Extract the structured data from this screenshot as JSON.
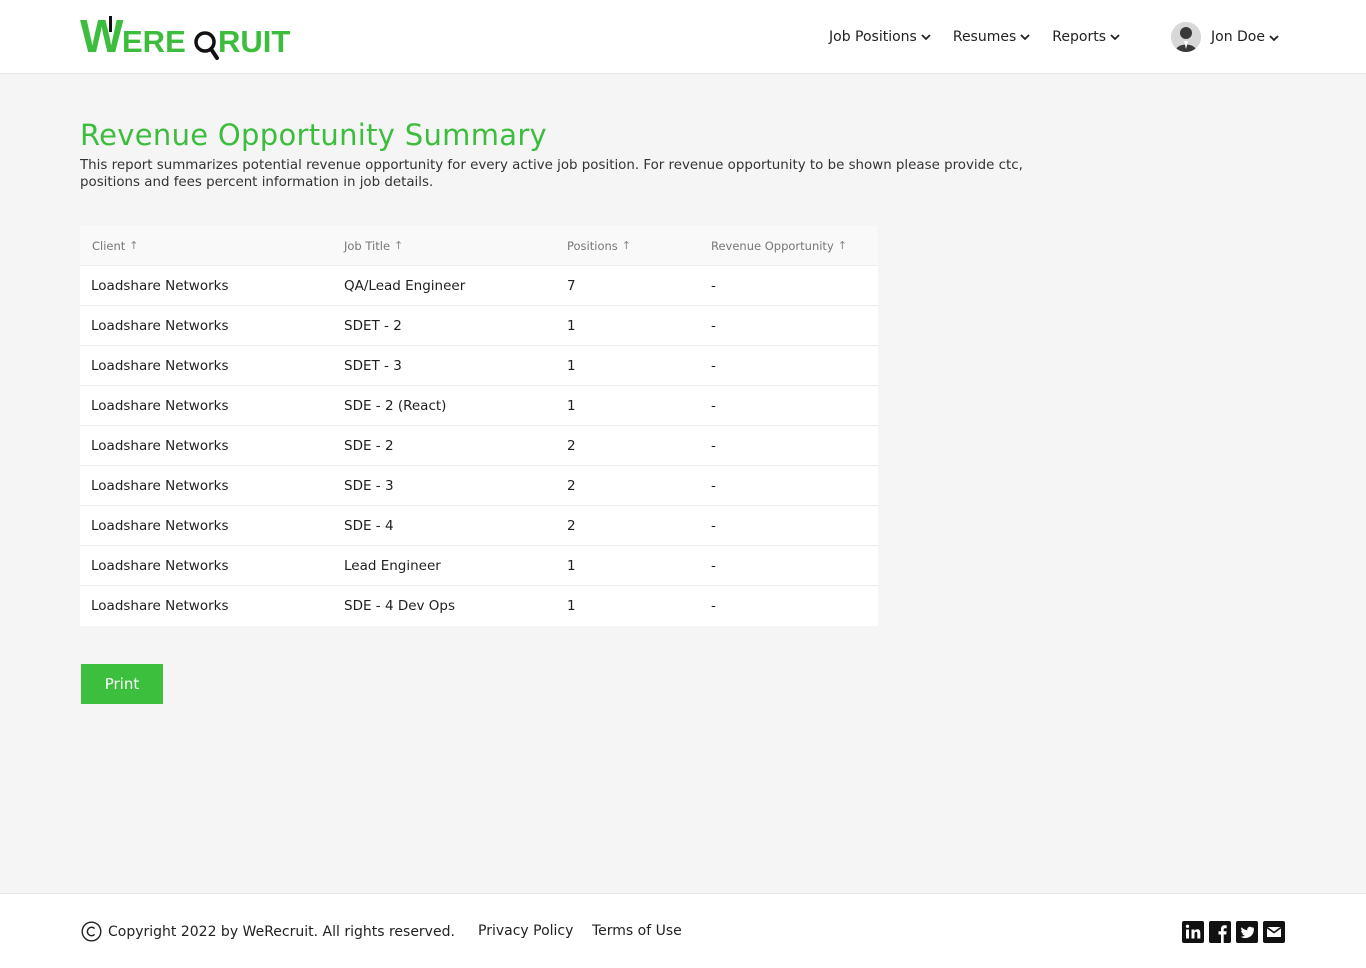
{
  "header": {
    "logo_text": "WERECRUIT",
    "nav": [
      {
        "label": "Job Positions"
      },
      {
        "label": "Resumes"
      },
      {
        "label": "Reports"
      }
    ],
    "user_name": "Jon Doe"
  },
  "page": {
    "title": "Revenue Opportunity Summary",
    "description": "This report summarizes potential revenue opportunity for every active job position. For revenue opportunity to be shown please provide ctc, positions and fees percent information in job details."
  },
  "table": {
    "columns": [
      "Client",
      "Job Title",
      "Positions",
      "Revenue Opportunity"
    ],
    "sort_arrow": "↑",
    "rows": [
      {
        "client": "Loadshare Networks",
        "job_title": "QA/Lead Engineer",
        "positions": "7",
        "revenue": "-"
      },
      {
        "client": "Loadshare Networks",
        "job_title": "SDET - 2",
        "positions": "1",
        "revenue": "-"
      },
      {
        "client": "Loadshare Networks",
        "job_title": "SDET - 3",
        "positions": "1",
        "revenue": "-"
      },
      {
        "client": "Loadshare Networks",
        "job_title": "SDE - 2 (React)",
        "positions": "1",
        "revenue": "-"
      },
      {
        "client": "Loadshare Networks",
        "job_title": "SDE - 2",
        "positions": "2",
        "revenue": "-"
      },
      {
        "client": "Loadshare Networks",
        "job_title": "SDE - 3",
        "positions": "2",
        "revenue": "-"
      },
      {
        "client": "Loadshare Networks",
        "job_title": "SDE - 4",
        "positions": "2",
        "revenue": "-"
      },
      {
        "client": "Loadshare Networks",
        "job_title": "Lead Engineer",
        "positions": "1",
        "revenue": "-"
      },
      {
        "client": "Loadshare Networks",
        "job_title": "SDE - 4 Dev Ops",
        "positions": "1",
        "revenue": "-"
      }
    ]
  },
  "actions": {
    "print_label": "Print"
  },
  "footer": {
    "copyright": "Copyright 2022 by WeRecruit. All rights reserved.",
    "privacy": "Privacy Policy",
    "terms": "Terms of Use",
    "social_icons": [
      "linkedin-icon",
      "facebook-icon",
      "twitter-icon",
      "email-icon"
    ]
  },
  "colors": {
    "brand_green": "#3dbd3d",
    "button_green": "#3cbf3c",
    "page_bg": "#f5f5f5"
  }
}
